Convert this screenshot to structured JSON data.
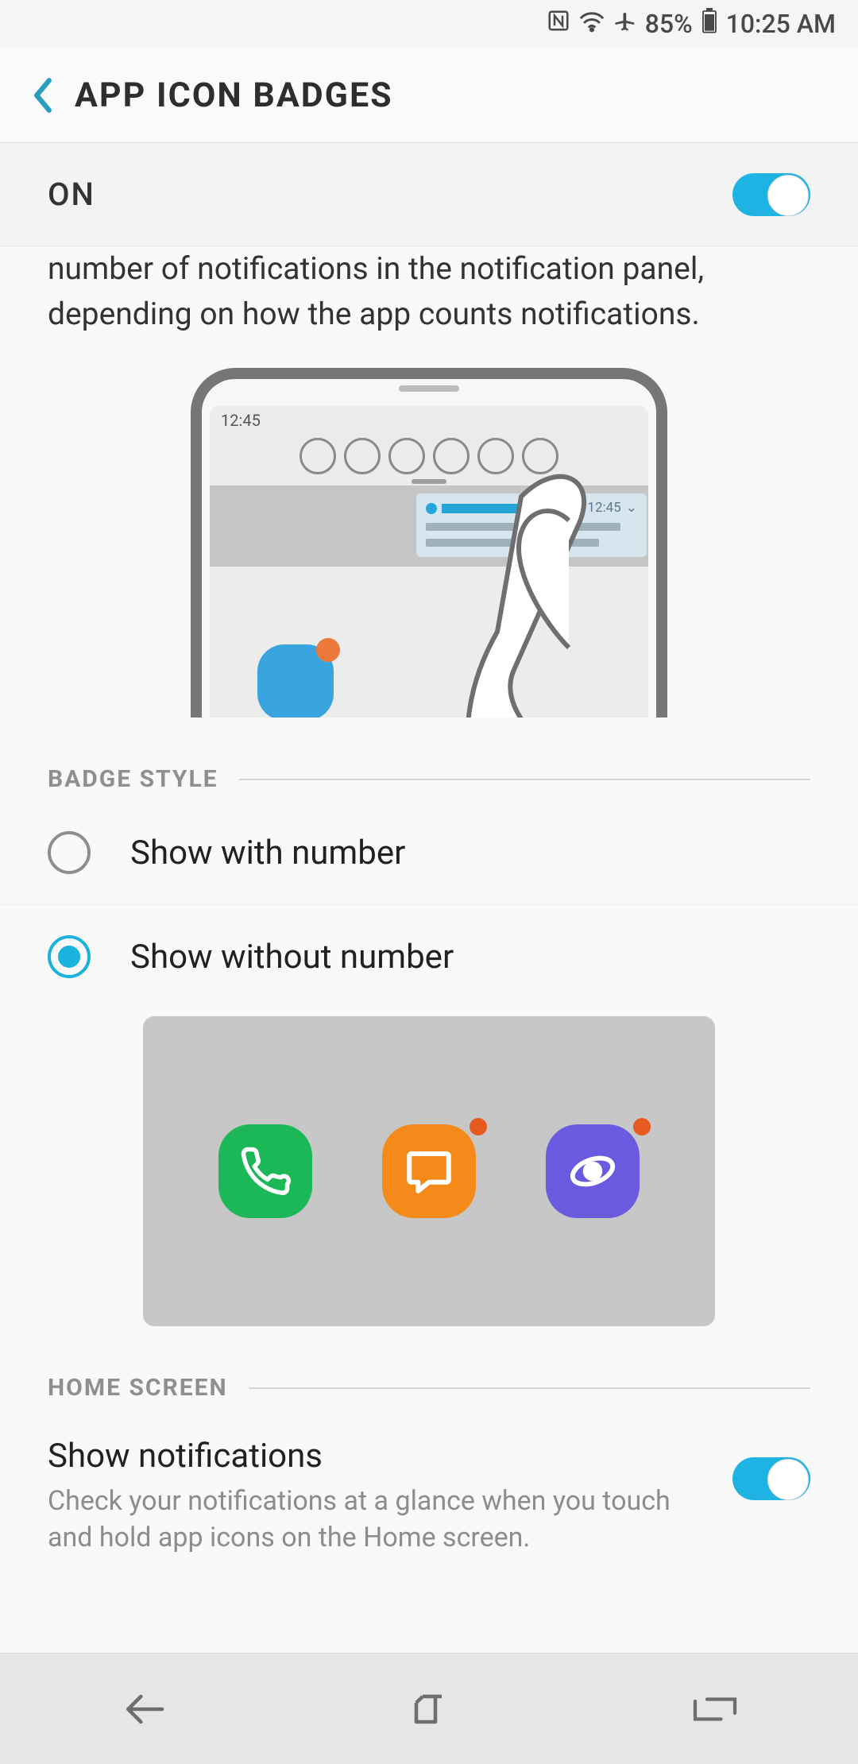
{
  "status": {
    "battery": "85%",
    "time": "10:25 AM"
  },
  "header": {
    "title": "APP ICON BADGES"
  },
  "master": {
    "label": "ON",
    "on": true
  },
  "description": "number of notifications in the notification panel, depending on how the app counts notifications.",
  "illustration": {
    "clock": "12:45",
    "notif_time": "12:45"
  },
  "sections": {
    "badge_style": "BADGE STYLE",
    "home_screen": "HOME SCREEN"
  },
  "badge_options": [
    {
      "label": "Show with number",
      "selected": false
    },
    {
      "label": "Show without number",
      "selected": true
    }
  ],
  "home_setting": {
    "title": "Show notifications",
    "subtitle": "Check your notifications at a glance when you touch and hold app icons on the Home screen.",
    "on": true
  }
}
